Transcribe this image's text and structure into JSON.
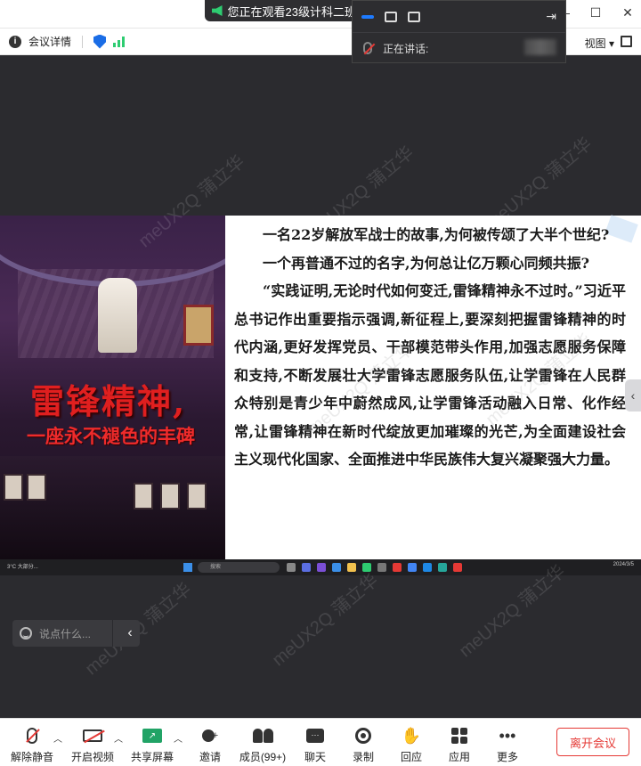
{
  "window": {
    "viewing_banner": "您正在观看23级计科二班",
    "minimize": "—",
    "maximize": "☐",
    "close": "✕"
  },
  "infobar": {
    "meeting_details": "会议详情",
    "view_label": "视图"
  },
  "speaker_panel": {
    "talking_label": "正在讲话:"
  },
  "shared_screen": {
    "poster": {
      "title_line1": "雷锋精神,",
      "title_line2": "一座永不褪色的丰碑"
    },
    "article": [
      "一名22岁解放军战士的故事,为何被传颂了大半个世纪?",
      "一个再普通不过的名字,为何总让亿万颗心同频共振?",
      "“实践证明,无论时代如何变迁,雷锋精神永不过时。”习近平总书记作出重要指示强调,新征程上,要深刻把握雷锋精神的时代内涵,更好发挥党员、干部模范带头作用,加强志愿服务保障和支持,不断发展壮大学雷锋志愿服务队伍,让学雷锋在人民群众特别是青少年中蔚然成风,让学雷锋活动融入日常、化作经常,让雷锋精神在新时代绽放更加璀璨的光芒,为全面建设社会主义现代化国家、全面推进中华民族伟大复兴凝聚强大力量。"
    ],
    "taskbar": {
      "weather": "3°C 大部分...",
      "search": "搜索",
      "tray": "2024/3/5"
    }
  },
  "watermark": "meUX2Q 蒲立华",
  "chat": {
    "placeholder": "说点什么..."
  },
  "toolbar": {
    "unmute": "解除静音",
    "start_video": "开启视频",
    "share_screen": "共享屏幕",
    "invite": "邀请",
    "members": "成员(99+)",
    "chat": "聊天",
    "record": "录制",
    "respond": "回应",
    "apps": "应用",
    "more": "更多",
    "leave": "离开会议"
  },
  "colors": {
    "accent_blue": "#1a6de6",
    "leave_red": "#e53935",
    "share_green": "#21a366",
    "stage_bg": "#2b2b2f"
  }
}
